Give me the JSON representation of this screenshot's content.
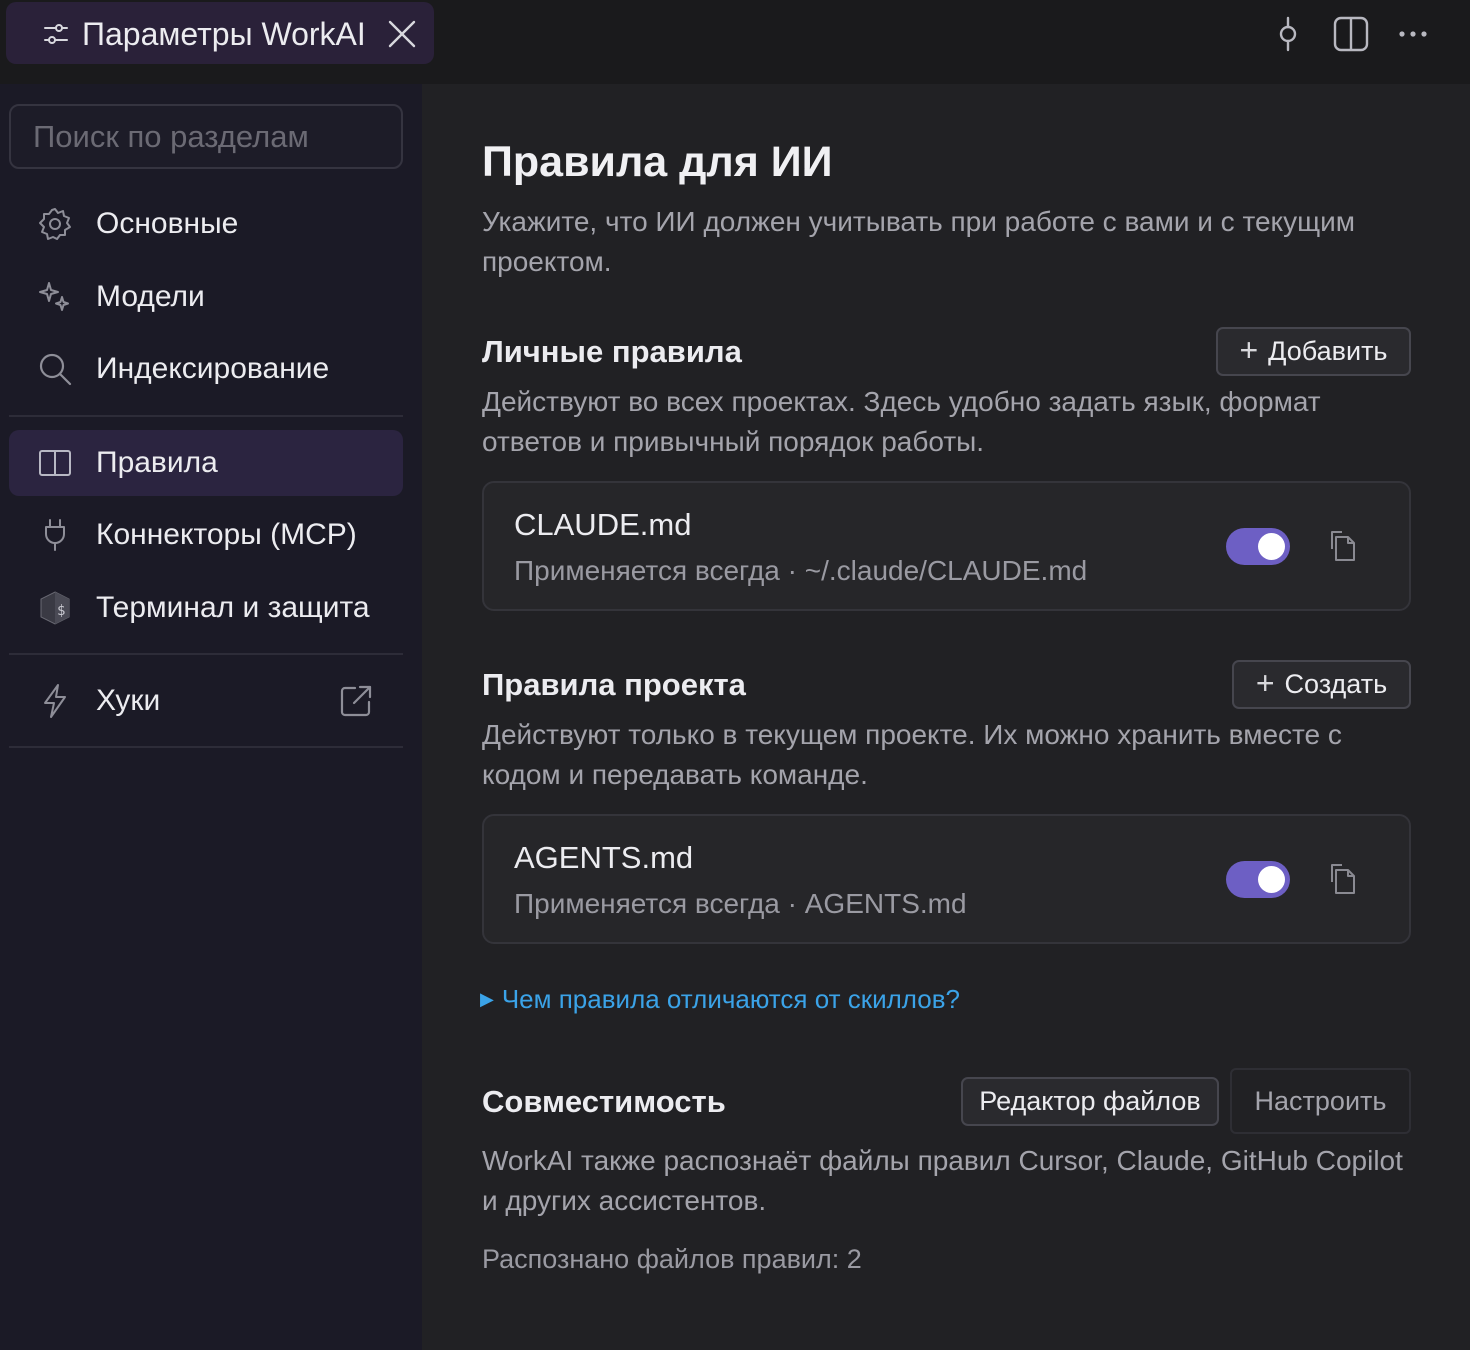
{
  "window": {
    "tab_title": "Параметры WorkAI",
    "tab_icon": "sliders-icon",
    "close_icon": "close-icon",
    "toolbar_icons": [
      "commit-icon",
      "split-view-icon",
      "more-icon"
    ]
  },
  "sidebar": {
    "search_placeholder": "Поиск по разделам",
    "items": [
      {
        "label": "Основные",
        "icon": "gear-icon"
      },
      {
        "label": "Модели",
        "icon": "sparkles-icon"
      },
      {
        "label": "Индексирование",
        "icon": "search-icon"
      },
      {
        "label": "Правила",
        "icon": "book-icon",
        "active": true
      },
      {
        "label": "Коннекторы (MCP)",
        "icon": "plug-icon"
      },
      {
        "label": "Терминал и защита",
        "icon": "shield-terminal-icon"
      },
      {
        "label": "Хуки",
        "icon": "lightning-icon",
        "external": true
      }
    ]
  },
  "main": {
    "title": "Правила для ИИ",
    "description": "Укажите, что ИИ должен учитывать при работе с вами и с текущим проектом.",
    "personal": {
      "title": "Личные правила",
      "button": "Добавить",
      "description": "Действуют во всех проектах. Здесь удобно задать язык, формат ответов и привычный порядок работы.",
      "file": {
        "name": "CLAUDE.md",
        "meta": "Применяется всегда · ~/.claude/CLAUDE.md",
        "enabled": true
      }
    },
    "project": {
      "title": "Правила проекта",
      "button": "Создать",
      "description": "Действуют только в текущем проекте. Их можно хранить вместе с кодом и передавать команде.",
      "file": {
        "name": "AGENTS.md",
        "meta": "Применяется всегда · AGENTS.md",
        "enabled": true
      }
    },
    "link": "Чем правила отличаются от скиллов?",
    "compat": {
      "title": "Совместимость",
      "button_editor": "Редактор файлов",
      "button_configure": "Настроить",
      "description": "WorkAI также распознаёт файлы правил Cursor, Claude, GitHub Copilot и других ассистентов.",
      "count": "Распознано файлов правил: 2"
    }
  },
  "colors": {
    "accent": "#6d5fc4",
    "link": "#3ba3e8",
    "sidebar_bg": "#1b1a26",
    "main_bg": "#212124",
    "active_item_bg": "#2b2440"
  }
}
